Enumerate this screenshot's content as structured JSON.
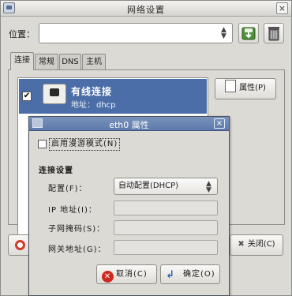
{
  "window": {
    "title": "网络设置",
    "close_glyph": "×",
    "location_label": "位置：",
    "location_value": "",
    "tabs": [
      {
        "label": "连接",
        "active": true
      },
      {
        "label": "常规",
        "active": false
      },
      {
        "label": "DNS",
        "active": false
      },
      {
        "label": "主机",
        "active": false
      }
    ],
    "connection": {
      "checked": true,
      "name": "有线连接",
      "address_label": "地址：",
      "address_value": "dhcp"
    },
    "properties_button": "属性(P)",
    "close_button": "关闭(C)",
    "icons": {
      "app": "network-settings-icon",
      "save": "save-location-icon",
      "delete": "delete-location-icon",
      "connection": "ethernet-icon",
      "help": "help-lifebuoy-icon"
    }
  },
  "dialog": {
    "title": "eth0 属性",
    "close_glyph": "×",
    "roaming_checkbox_label": "启用漫游模式(N)",
    "roaming_checked": false,
    "section_title": "连接设置",
    "config_label": "配置(F)：",
    "config_value": "自动配置(DHCP)",
    "ip_label": "IP 地址(I)：",
    "ip_value": "",
    "mask_label": "子网掩码(S)：",
    "mask_value": "",
    "gateway_label": "网关地址(G)：",
    "gateway_value": "",
    "cancel_button": "取消(C)",
    "ok_button": "确定(O)"
  },
  "colors": {
    "selection": "#4b6ea8",
    "dialog_titlebar": "#5e7aab",
    "window_bg": "#dcdad5"
  }
}
